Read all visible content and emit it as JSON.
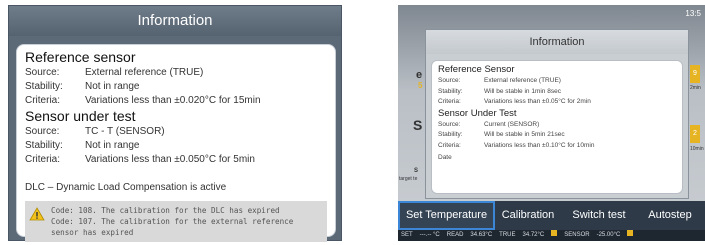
{
  "left": {
    "title": "Information",
    "reference": {
      "heading": "Reference sensor",
      "rows": [
        {
          "label": "Source:",
          "value": "External reference (TRUE)"
        },
        {
          "label": "Stability:",
          "value": "Not in range"
        },
        {
          "label": "Criteria:",
          "value": "Variations less than ±0.020°C for 15min"
        }
      ]
    },
    "sut": {
      "heading": "Sensor under test",
      "rows": [
        {
          "label": "Source:",
          "value": "TC - T (SENSOR)"
        },
        {
          "label": "Stability:",
          "value": "Not in range"
        },
        {
          "label": "Criteria:",
          "value": "Variations less than ±0.050°C for 5min"
        }
      ]
    },
    "dlc": "DLC – Dynamic Load Compensation is active",
    "warnings": [
      "Code: 108. The calibration for the DLC has expired",
      "Code: 107. The calibration for the external reference sensor has expired"
    ],
    "warning_icon": "warning-triangle-icon",
    "warning_color": "#f2c21b"
  },
  "right": {
    "corner_text": "13:5",
    "dialog_title": "Information",
    "reference": {
      "heading": "Reference Sensor",
      "rows": [
        {
          "label": "Source:",
          "value": "External reference (TRUE)"
        },
        {
          "label": "Stability:",
          "value": "Will be stable in 1min 8sec"
        },
        {
          "label": "Criteria:",
          "value": "Variations less than ±0.05°C for 2min"
        }
      ]
    },
    "sut": {
      "heading": "Sensor Under Test",
      "rows": [
        {
          "label": "Source:",
          "value": "Current (SENSOR)"
        },
        {
          "label": "Stability:",
          "value": "Will be stable in 5min 21sec"
        },
        {
          "label": "Criteria:",
          "value": "Variations less than ±0.10°C for 10min"
        }
      ]
    },
    "date_label": "Date",
    "background": {
      "letter_top": "e",
      "digit_top": "5",
      "letter_mid": "S",
      "s_small": "S",
      "target_label": "target te",
      "yellow_top": "9",
      "yellow_mid": "2",
      "label_2min": "2min",
      "label_10min": "10min"
    },
    "toolbar": [
      "Set Temperature",
      "Calibration",
      "Switch test",
      "Autostep"
    ],
    "toolbar_active": "Set Temperature",
    "status": {
      "set_label": "SET",
      "set_value": "---.-- °C",
      "read_label": "READ",
      "read_value": "34.63°C",
      "true_label": "TRUE",
      "true_value": "34.72°C",
      "sensor_label": "SENSOR",
      "sensor_value": "-25.00°C"
    },
    "accent_color": "#3c86d8"
  }
}
